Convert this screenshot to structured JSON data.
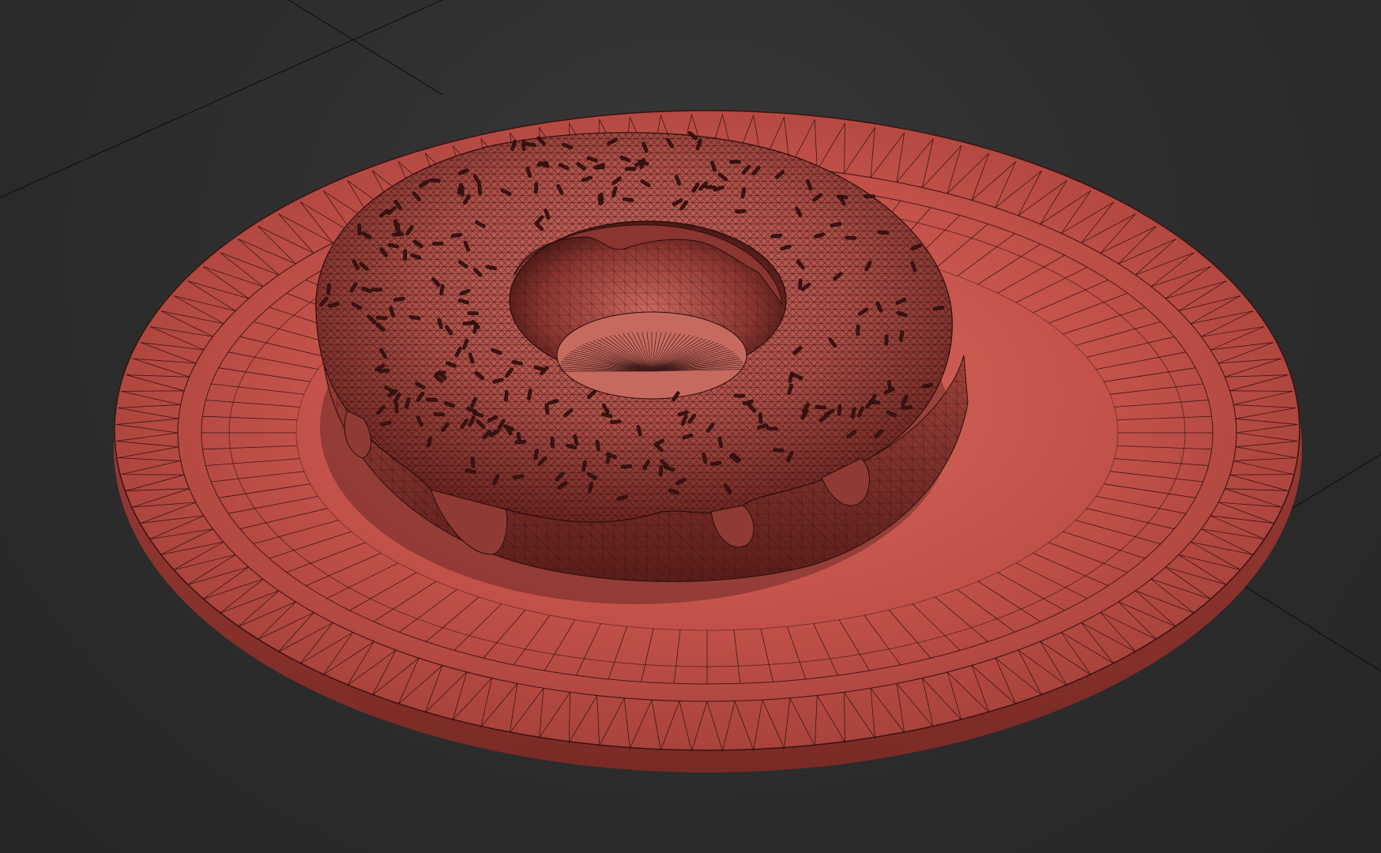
{
  "viewport": {
    "background": "#2e2e2e",
    "grid_line_color": "#111111",
    "wire_color": "#2a0d0b"
  },
  "objects": [
    {
      "name": "plate",
      "type": "cylinder",
      "display": "shaded-wireframe",
      "color": "#c4524a"
    },
    {
      "name": "donut",
      "type": "torus",
      "display": "shaded-wireframe",
      "color": "#b04a44"
    },
    {
      "name": "icing",
      "type": "mesh",
      "display": "shaded-wireframe",
      "color": "#9e3f3a"
    },
    {
      "name": "sprinkles",
      "type": "scattered-mesh",
      "display": "shaded-wireframe",
      "color": "#3a1412"
    }
  ]
}
